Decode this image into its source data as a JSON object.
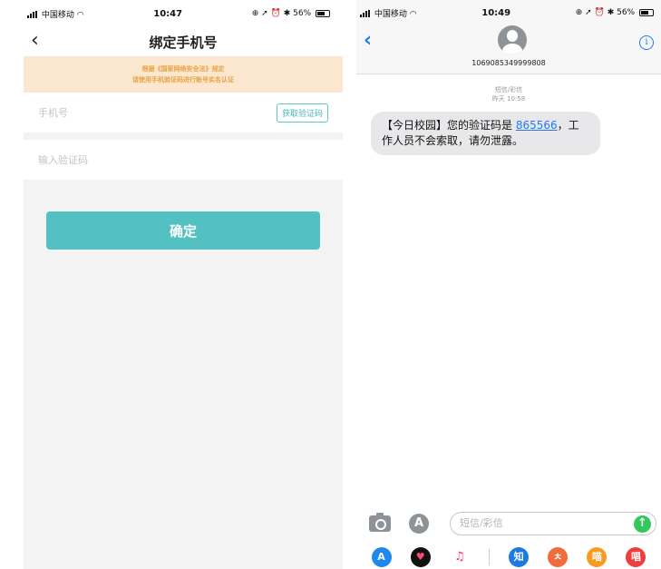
{
  "left": {
    "status": {
      "carrier": "中国移动",
      "time": "10:47",
      "battery": "56%"
    },
    "nav": {
      "back": "‹",
      "title": "绑定手机号"
    },
    "notice": {
      "line1": "根据《国家网络安全法》规定",
      "line2": "请使用手机验证码进行账号实名认证"
    },
    "phone_placeholder": "手机号",
    "get_code_label": "获取验证码",
    "code_placeholder": "输入验证码",
    "confirm_label": "确定"
  },
  "right": {
    "status": {
      "carrier": "中国移动",
      "time": "10:49",
      "battery": "56%"
    },
    "header": {
      "back": "‹",
      "number": "1069085349999808",
      "info": "i"
    },
    "meta": {
      "type": "短信/彩信",
      "time": "昨天 10:58"
    },
    "message": {
      "prefix": "【今日校园】您的验证码是",
      "code": "865566",
      "suffix": "，工作人员不会索取，请勿泄露。"
    },
    "compose_placeholder": "短信/彩信",
    "send": "↑",
    "apps": [
      "A",
      "♥",
      "♫",
      "知",
      "ㅊ",
      "喵",
      "唱"
    ]
  },
  "colors": {
    "teal": "#53c1c2",
    "ios_blue": "#1e7cf2",
    "notice_bg": "#fbe6cf",
    "notice_text": "#e8a441",
    "bubble": "#e8e8ea",
    "send_green": "#34c759"
  }
}
